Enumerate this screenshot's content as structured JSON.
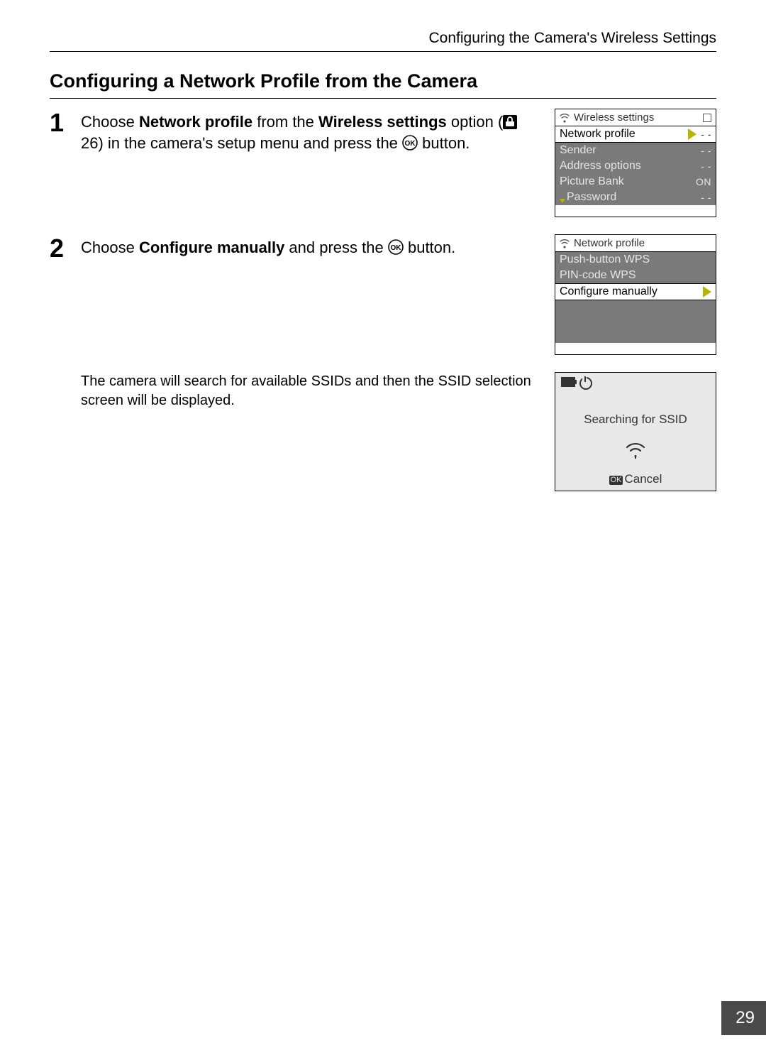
{
  "running_head": "Configuring the Camera's Wireless Settings",
  "section_title": "Configuring a Network Profile from the Camera",
  "page_number": "29",
  "step1": {
    "num": "1",
    "text_pre": "Choose ",
    "bold1": "Network profile",
    "mid1": " from the ",
    "bold2": "Wireless settings",
    "mid2": " option (",
    "ref_num": " 26",
    "mid3": ") in the camera's setup menu and press the ",
    "after_ok": " button."
  },
  "screen1": {
    "title": "Wireless settings",
    "rows": [
      {
        "label": "Network profile",
        "val": "- -",
        "sel": true
      },
      {
        "label": "Sender",
        "val": "- -",
        "sel": false
      },
      {
        "label": "Address options",
        "val": "- -",
        "sel": false
      },
      {
        "label": "Picture Bank",
        "val": "ON",
        "sel": false
      },
      {
        "label": "Password",
        "val": "- -",
        "sel": false
      }
    ]
  },
  "step2": {
    "num": "2",
    "text_pre": "Choose ",
    "bold1": "Configure manually",
    "mid1": " and press the ",
    "after_ok": " button."
  },
  "screen2": {
    "title": "Network profile",
    "rows": [
      {
        "label": "Push-button WPS",
        "sel": false
      },
      {
        "label": "PIN-code WPS",
        "sel": false
      },
      {
        "label": "Configure manually",
        "sel": true
      }
    ]
  },
  "sub_note": "The camera will search for available SSIDs and then the SSID selection screen will be displayed.",
  "ssid_screen": {
    "msg": "Searching for SSID",
    "cancel": "Cancel",
    "ok": "OK"
  }
}
